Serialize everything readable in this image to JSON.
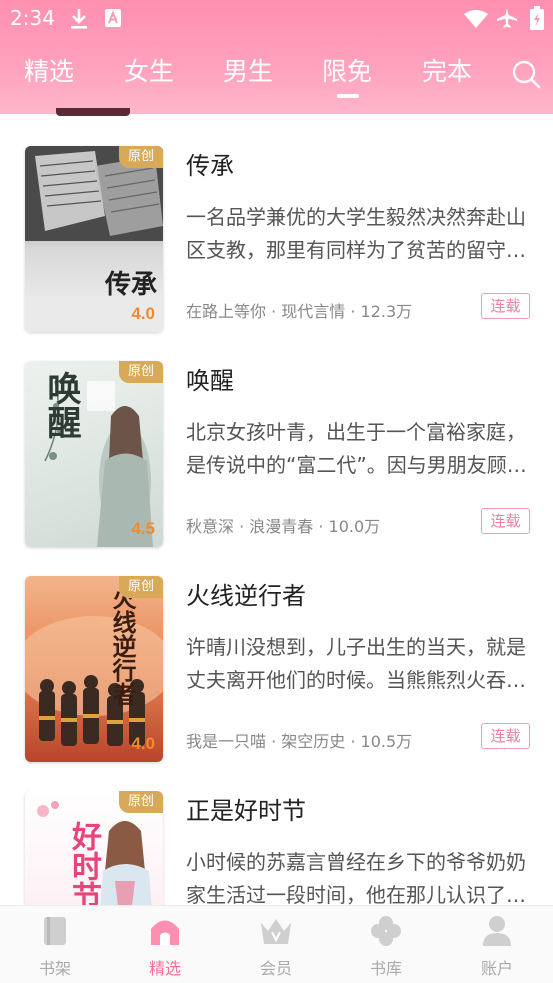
{
  "status_bar": {
    "time": "2:34"
  },
  "tabs": [
    {
      "label": "精选"
    },
    {
      "label": "女生"
    },
    {
      "label": "男生"
    },
    {
      "label": "限免"
    },
    {
      "label": "完本"
    }
  ],
  "active_tab": "限免",
  "books": [
    {
      "title": "传承",
      "badge": "原创",
      "rating": "4.0",
      "cover_text": "传承",
      "desc_line1": "一名品学兼优的大学生毅然决然奔赴山",
      "desc_line2": "区支教，那里有同样为了贫苦的留守…",
      "meta": "在路上等你 · 现代言情 · 12.3万",
      "status": "连载"
    },
    {
      "title": "唤醒",
      "badge": "原创",
      "rating": "4.5",
      "cover_text": "唤醒",
      "desc_line1": "北京女孩叶青，出生于一个富裕家庭，",
      "desc_line2": "是传说中的“富二代”。因与男朋友顾…",
      "meta": "秋意深 · 浪漫青春 · 10.0万",
      "status": "连载"
    },
    {
      "title": "火线逆行者",
      "badge": "原创",
      "rating": "4.0",
      "cover_text": "火线逆行者",
      "desc_line1": "许晴川没想到，儿子出生的当天，就是",
      "desc_line2": "丈夫离开他们的时候。当熊熊烈火吞…",
      "meta": "我是一只喵 · 架空历史 · 10.5万",
      "status": "连载"
    },
    {
      "title": "正是好时节",
      "badge": "原创",
      "rating": "",
      "cover_text": "好时节",
      "desc_line1": "小时候的苏嘉言曾经在乡下的爷爷奶奶",
      "desc_line2": "家生活过一段时间，他在那儿认识了…",
      "meta": "",
      "status": ""
    }
  ],
  "bottom_nav": [
    {
      "label": "书架",
      "icon": "bookshelf-icon"
    },
    {
      "label": "精选",
      "icon": "home-icon"
    },
    {
      "label": "会员",
      "icon": "crown-icon"
    },
    {
      "label": "书库",
      "icon": "library-icon"
    },
    {
      "label": "账户",
      "icon": "account-icon"
    }
  ],
  "colors": {
    "header_gradient_top": "#ff8fb0",
    "accent_pink": "#ff6f97",
    "badge_gold": "#d9a95a",
    "rating_orange": "#f08a2c"
  }
}
